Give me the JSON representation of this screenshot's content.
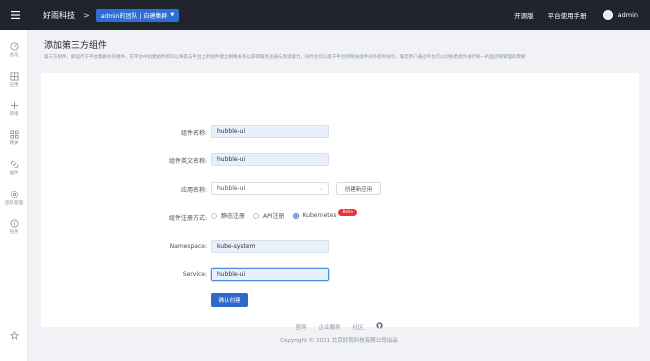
{
  "header": {
    "brand": "好雨科技",
    "crumb_separator": ">",
    "team_label": "admin的团队 | 自建集群",
    "links": {
      "open_source": "开源版",
      "manual": "平台使用手册"
    },
    "user": "admin"
  },
  "sidebar": {
    "items": [
      {
        "label": "总览",
        "icon": "dashboard-icon"
      },
      {
        "label": "应用",
        "icon": "app-icon"
      },
      {
        "label": "新增",
        "icon": "plus-icon"
      },
      {
        "label": "网关",
        "icon": "gateway-icon"
      },
      {
        "label": "插件",
        "icon": "plugin-icon"
      },
      {
        "label": "团队管理",
        "icon": "gear-icon"
      },
      {
        "label": "任务",
        "icon": "info-icon"
      }
    ],
    "bottom_icon": "star-icon"
  },
  "page": {
    "title": "添加第三方组件",
    "description": "第三方组件，即运行于平台集群外的组件，在平台中创建组件即可以将其与平台上的组件建立网络关系以获得服务注册与发现能力，同时也可以基于平台的网关组件对外提供访问，满足用户通过平台可以对各类组件进行统一的监控和管理的需要"
  },
  "form": {
    "component_name": {
      "label": "组件名称:",
      "value": "hubble-ui"
    },
    "component_en_name": {
      "label": "组件英文名称:",
      "value": "hubble-ui"
    },
    "app_name": {
      "label": "应用名称:",
      "value": "hubble-ui",
      "create_button": "创建新应用"
    },
    "register_mode": {
      "label": "组件注册方式:",
      "options": [
        "静态注册",
        "API注册",
        "Kubernetes"
      ],
      "selected": "Kubernetes",
      "badge": "Beta"
    },
    "namespace": {
      "label": "Namespace:",
      "value": "kube-system"
    },
    "service": {
      "label": "Service:",
      "value": "hubble-ui"
    },
    "submit": "确认创建"
  },
  "footer": {
    "links": [
      "官网",
      "企业服务",
      "社区"
    ],
    "copyright": "Copyright © 2021 北京好雨科技有限公司出品"
  },
  "colors": {
    "topbar": "#20252d",
    "accent": "#2e68c8",
    "beta": "#e8353b",
    "input_fill": "#e8f0fe"
  }
}
